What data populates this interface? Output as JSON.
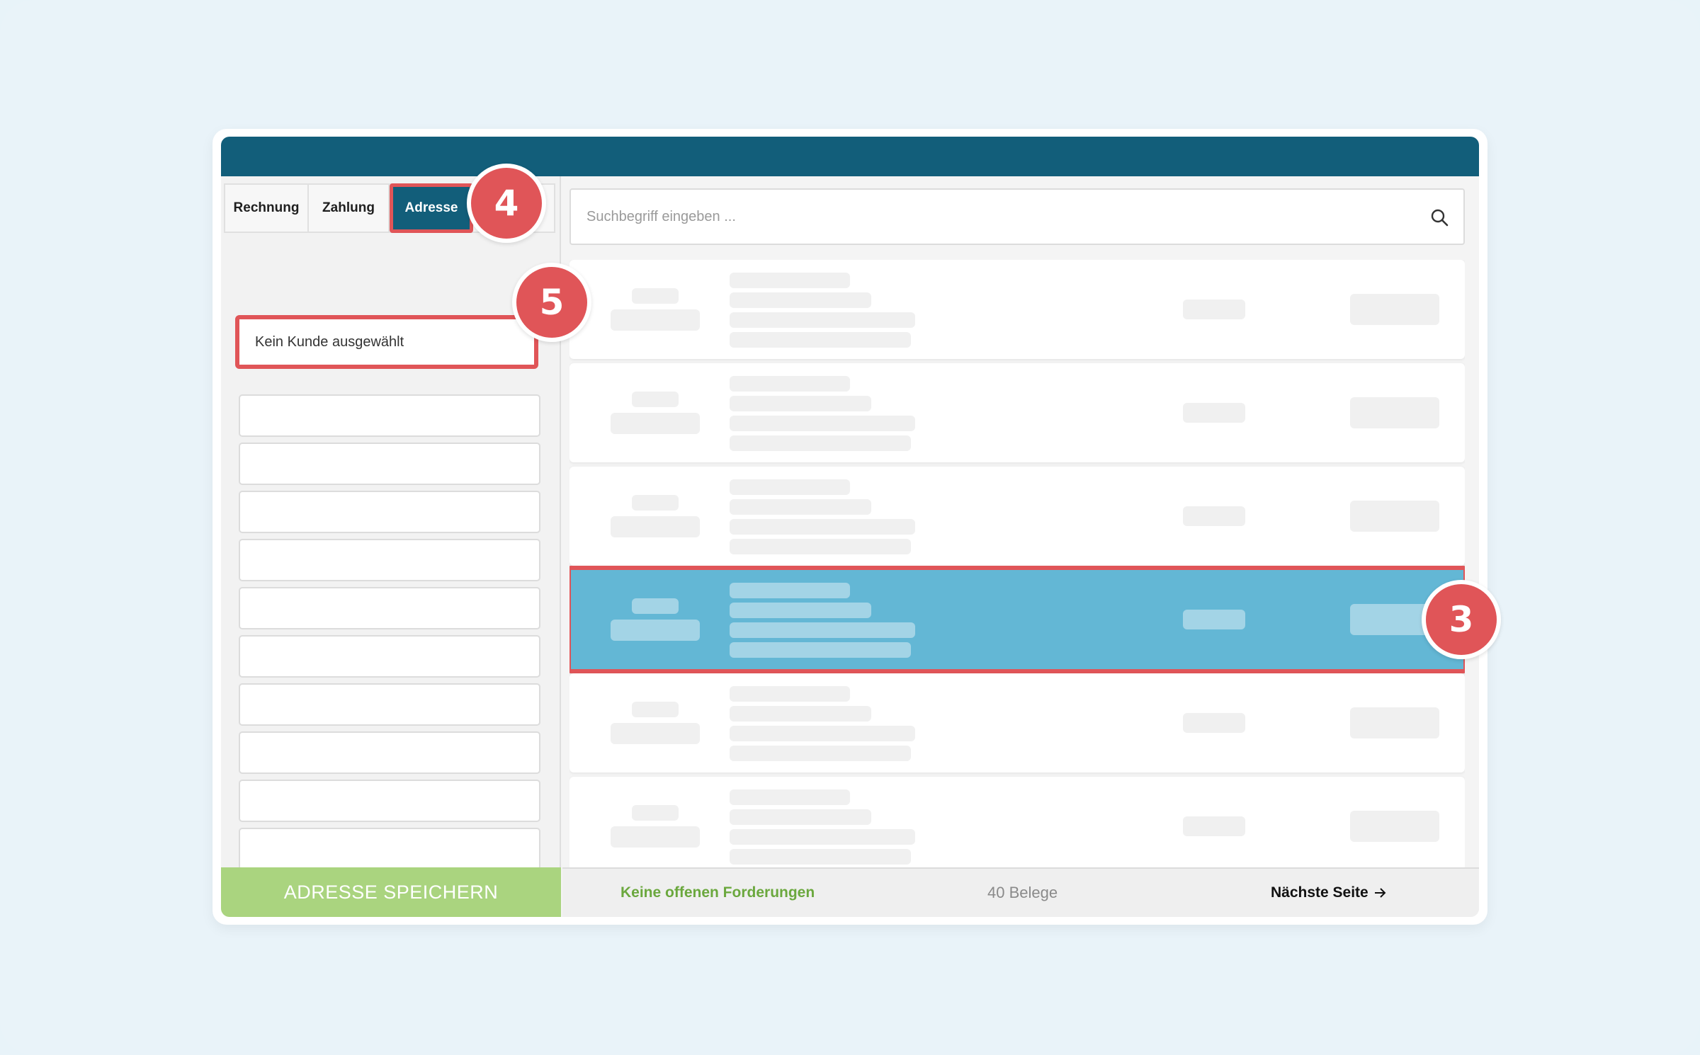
{
  "tabs": [
    {
      "label": "Rechnung"
    },
    {
      "label": "Zahlung"
    },
    {
      "label": "Adresse"
    }
  ],
  "left": {
    "customer_placeholder": "Kein Kunde ausgewählt",
    "save_label": "ADRESSE SPEICHERN"
  },
  "search": {
    "placeholder": "Suchbegriff eingeben ...",
    "icon": "search-icon"
  },
  "footer": {
    "open_claims": "Keine offenen Forderungen",
    "count": "40 Belege",
    "next": "Nächste Seite",
    "next_icon": "arrow-right-icon"
  },
  "callouts": {
    "a": "4",
    "b": "5",
    "c": "3"
  },
  "colors": {
    "topbar": "#125e7a",
    "selected_row": "#63b7d5",
    "highlight": "#e05558",
    "save_button": "#aad47f",
    "open_claims_text": "#6ba83e"
  }
}
